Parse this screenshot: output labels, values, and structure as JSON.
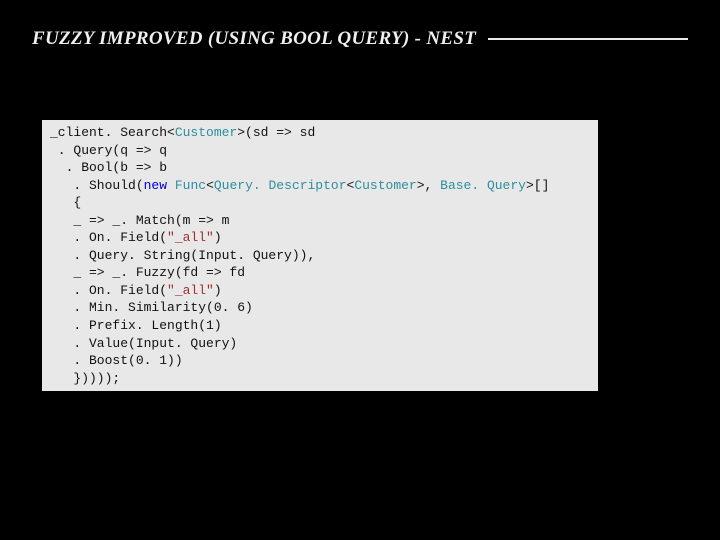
{
  "title": "FUZZY IMPROVED (USING BOOL QUERY) - NEST",
  "code": {
    "l01a": "_client. Search<",
    "l01_type1": "Customer",
    "l01b": ">(sd => sd",
    "l02": " . Query(q => q",
    "l03": "  . Bool(b => b",
    "l04a": "   . Should(",
    "l04_kw": "new",
    "l04b": " ",
    "l04_type2": "Func",
    "l04c": "<",
    "l04_type3": "Query. Descriptor",
    "l04d": "<",
    "l04_type4": "Customer",
    "l04e": ">, ",
    "l04_type5": "Base. Query",
    "l04f": ">[]",
    "l05": "   {",
    "l06": "   _ => _. Match(m => m",
    "l07a": "   . On. Field(",
    "l07_str": "\"_all\"",
    "l07b": ")",
    "l08": "   . Query. String(Input. Query)),",
    "l09": "   _ => _. Fuzzy(fd => fd",
    "l10a": "   . On. Field(",
    "l10_str": "\"_all\"",
    "l10b": ")",
    "l11a": "   . Min. Similarity(",
    "l11_num": "0. 6",
    "l11b": ")",
    "l12a": "   . Prefix. Length(",
    "l12_num": "1",
    "l12b": ")",
    "l13": "   . Value(Input. Query)",
    "l14a": "   . Boost(",
    "l14_num": "0. 1",
    "l14b": "))",
    "l15": "   }))));"
  }
}
